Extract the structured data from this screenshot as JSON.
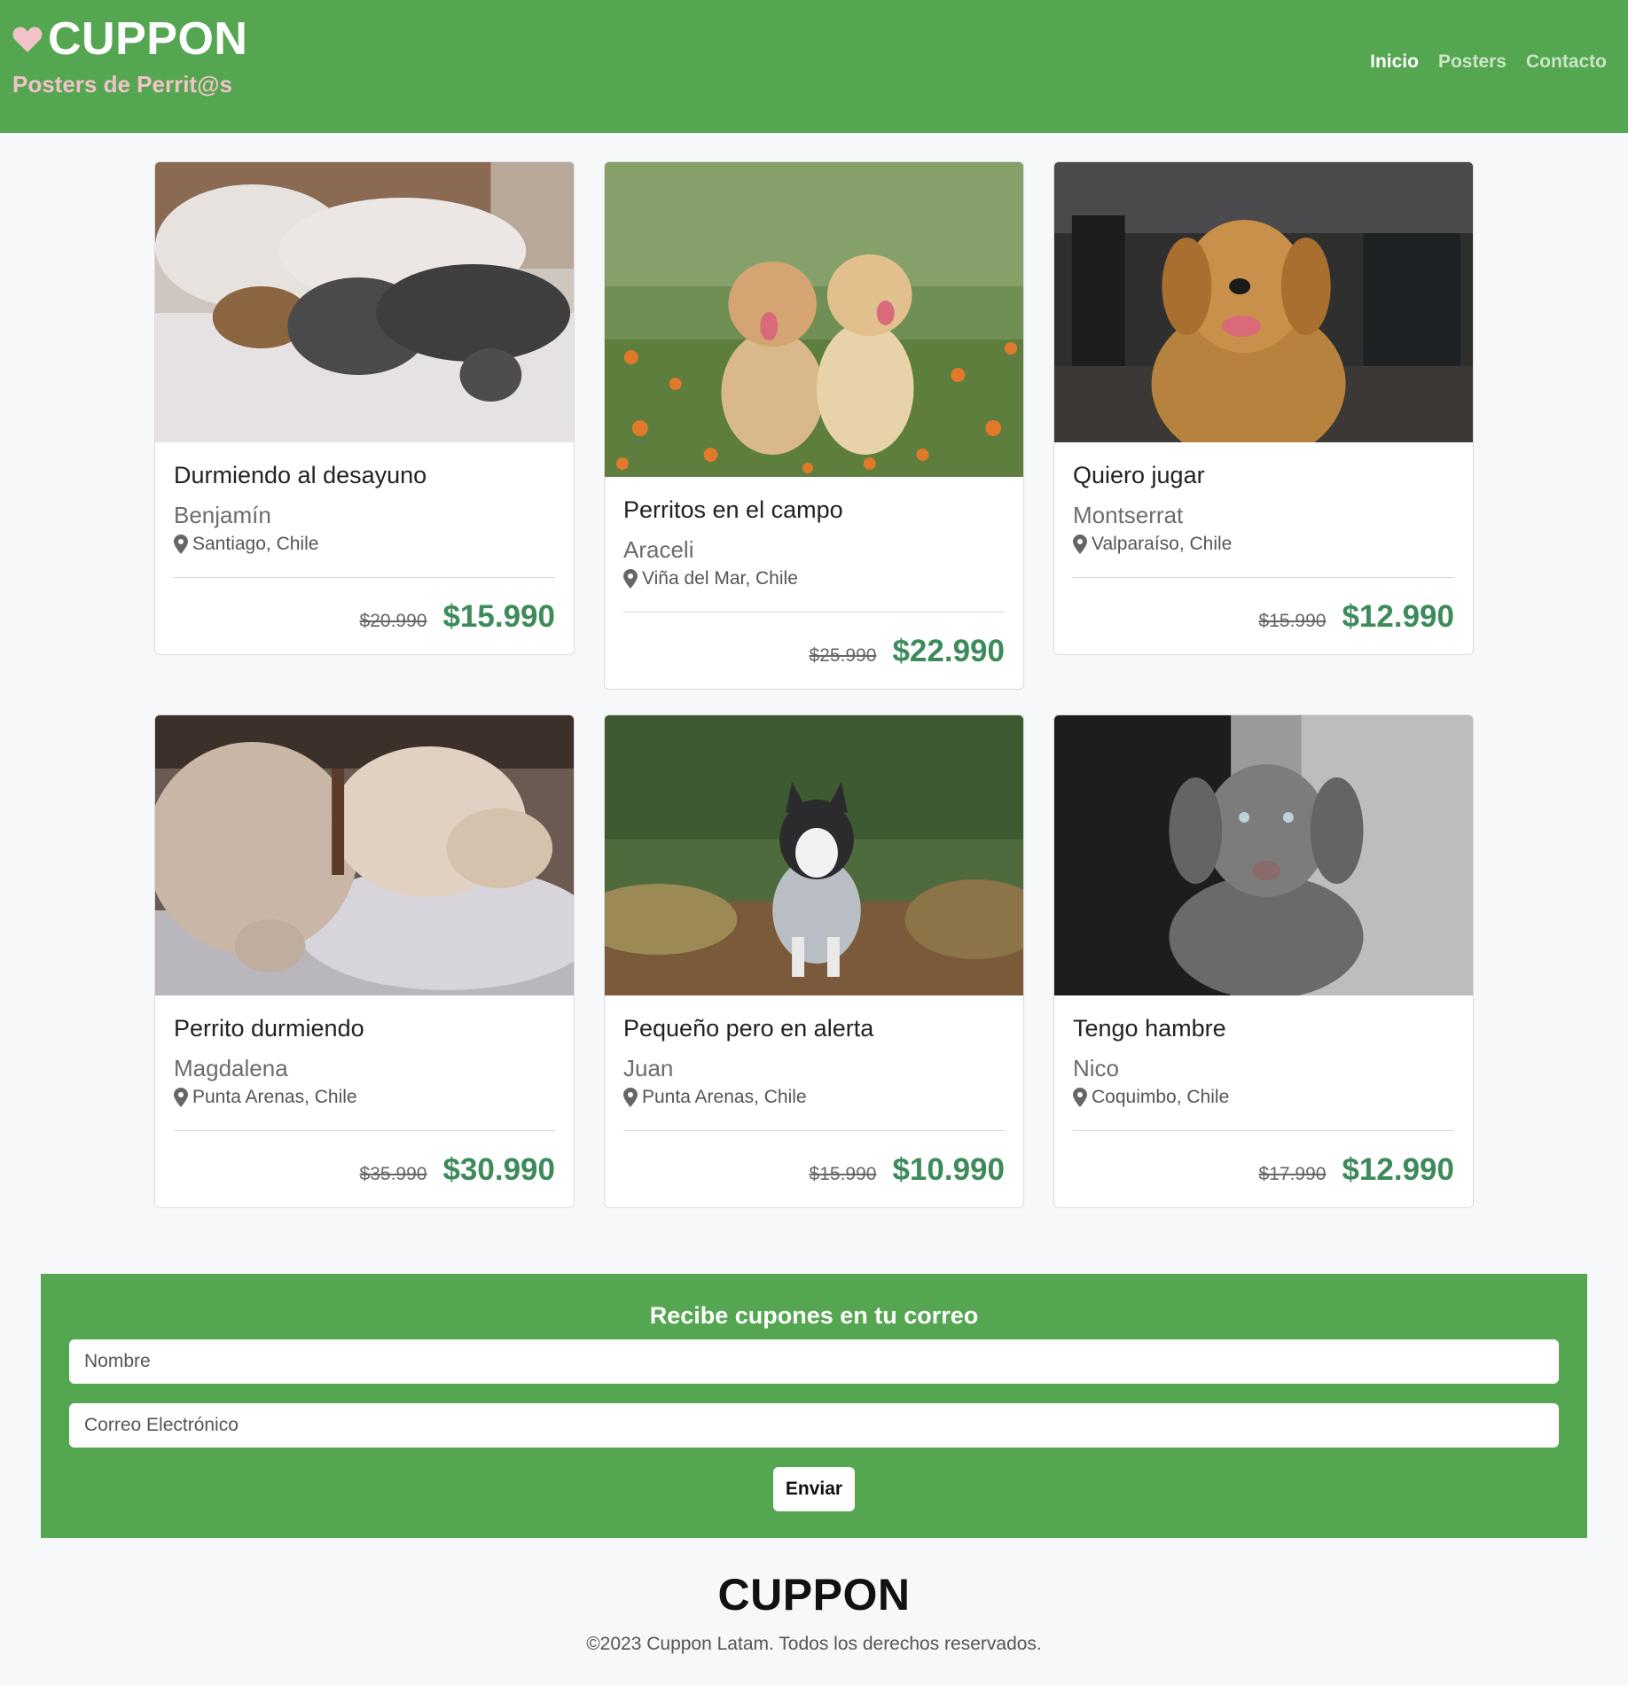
{
  "header": {
    "brand_title": "CUPPON",
    "brand_subtitle": "Posters de Perrit@s",
    "nav": [
      "Inicio",
      "Posters",
      "Contacto"
    ]
  },
  "cards": [
    {
      "title": "Durmiendo al desayuno",
      "author": "Benjamín",
      "location": "Santiago, Chile",
      "old_price": "$20.990",
      "price": "$15.990"
    },
    {
      "title": "Perritos en el campo",
      "author": "Araceli",
      "location": "Viña del Mar, Chile",
      "old_price": "$25.990",
      "price": "$22.990"
    },
    {
      "title": "Quiero jugar",
      "author": "Montserrat",
      "location": "Valparaíso, Chile",
      "old_price": "$15.990",
      "price": "$12.990"
    },
    {
      "title": "Perrito durmiendo",
      "author": "Magdalena",
      "location": "Punta Arenas, Chile",
      "old_price": "$35.990",
      "price": "$30.990"
    },
    {
      "title": "Pequeño pero en alerta",
      "author": "Juan",
      "location": "Punta Arenas, Chile",
      "old_price": "$15.990",
      "price": "$10.990"
    },
    {
      "title": "Tengo hambre",
      "author": "Nico",
      "location": "Coquimbo, Chile",
      "old_price": "$17.990",
      "price": "$12.990"
    }
  ],
  "newsletter": {
    "title": "Recibe cupones en tu correo",
    "name_placeholder": "Nombre",
    "email_placeholder": "Correo Electrónico",
    "submit_label": "Enviar"
  },
  "footer": {
    "logo": "CUPPON",
    "copyright": "©2023 Cuppon Latam. Todos los derechos reservados."
  },
  "colors": {
    "brand_green": "#54a651",
    "price_green": "#3d8b5a",
    "subtitle_pink": "#f2c3c8"
  },
  "icons": [
    "heart-icon",
    "location-pin-icon"
  ]
}
